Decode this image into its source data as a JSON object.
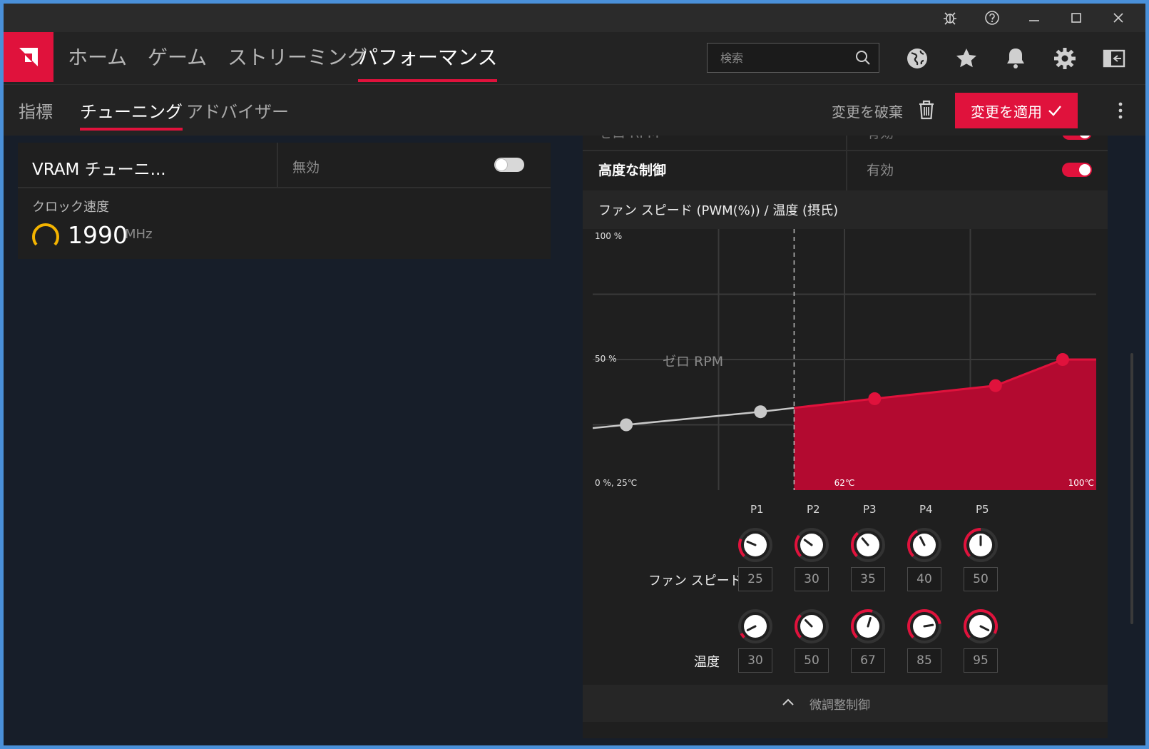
{
  "window": {
    "titlebar_icons": [
      "bug-icon",
      "help-icon",
      "minimize-icon",
      "maximize-icon",
      "close-icon"
    ]
  },
  "nav": {
    "items": [
      {
        "label": "ホーム",
        "active": false
      },
      {
        "label": "ゲーム",
        "active": false
      },
      {
        "label": "ストリーミング",
        "active": false
      },
      {
        "label": "パフォーマンス",
        "active": true
      }
    ],
    "search_placeholder": "検索",
    "icons": [
      "globe-icon",
      "star-icon",
      "bell-icon",
      "gear-icon",
      "sidebar-icon"
    ]
  },
  "subnav": {
    "items": [
      {
        "label": "指標",
        "active": false
      },
      {
        "label": "チューニング",
        "active": true
      },
      {
        "label": "アドバイザー",
        "active": false
      }
    ],
    "discard_label": "変更を破棄",
    "apply_label": "変更を適用"
  },
  "vram": {
    "title": "VRAM チューニ...",
    "state": "無効",
    "enabled": false,
    "clock_label": "クロック速度",
    "clock_value": "1990",
    "clock_unit": "MHz"
  },
  "fan": {
    "zero_rpm_row": {
      "label": "ゼロ RPM",
      "state": "有効"
    },
    "advanced": {
      "label": "高度な制御",
      "state": "有効",
      "enabled": true
    },
    "header": "ファン スピード (PWM(%)) / 温度 (摂氏)",
    "accent": "#e0123c",
    "chart_data": {
      "type": "area",
      "y_labels": [
        "100 %",
        "50 %",
        "0 %, 25℃"
      ],
      "x_labels": [
        "62℃",
        "100℃"
      ],
      "zero_rpm_label": "ゼロ RPM",
      "zero_rpm_threshold_c": 55,
      "xlim": [
        25,
        100
      ],
      "ylim": [
        0,
        100
      ],
      "points": [
        {
          "temp": 30,
          "speed": 25
        },
        {
          "temp": 50,
          "speed": 30
        },
        {
          "temp": 67,
          "speed": 35
        },
        {
          "temp": 85,
          "speed": 40
        },
        {
          "temp": 95,
          "speed": 50
        }
      ]
    },
    "point_names": [
      "P1",
      "P2",
      "P3",
      "P4",
      "P5"
    ],
    "speed_label": "ファン スピード",
    "temp_label": "温度",
    "speed_values": [
      "25",
      "30",
      "35",
      "40",
      "50"
    ],
    "temp_values": [
      "30",
      "50",
      "67",
      "85",
      "95"
    ],
    "fine_control_label": "微調整制御"
  }
}
